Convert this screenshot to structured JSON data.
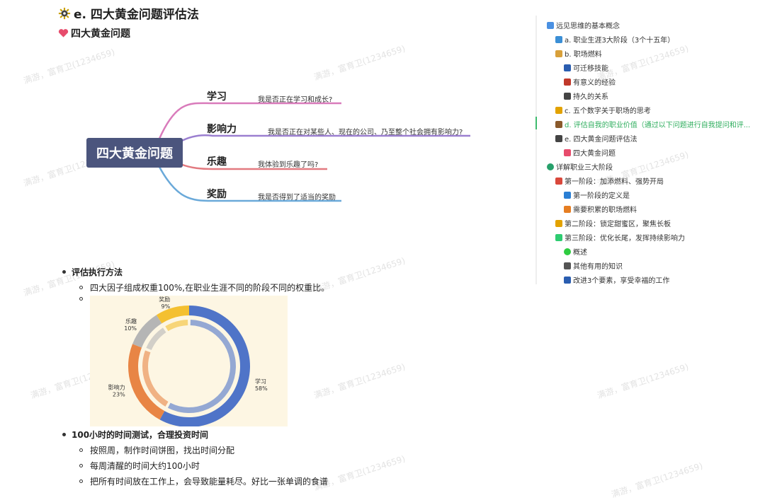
{
  "page": {
    "title": "e. 四大黄金问题评估法",
    "subtitle": "四大黄金问题"
  },
  "mindmap": {
    "center": "四大黄金问题",
    "branches": [
      {
        "label": "学习",
        "question": "我是否正在学习和成长?",
        "color": "#d97bbb"
      },
      {
        "label": "影响力",
        "question": "我是否正在对某些人、现在的公司、乃至整个社会拥有影响力?",
        "color": "#9b7fd0"
      },
      {
        "label": "乐趣",
        "question": "我体验到乐趣了吗?",
        "color": "#e27a80"
      },
      {
        "label": "奖励",
        "question": "我是否得到了适当的奖励",
        "color": "#6aa9d9"
      }
    ]
  },
  "bullets": {
    "item1": {
      "label": "评估执行方法",
      "subs": [
        "四大因子组成权重100%,在职业生涯不同的阶段不同的权重比。"
      ]
    },
    "item2": {
      "label": "100小时的时间测试，合理投资时间",
      "subs": [
        "按照周，制作时间饼图，找出时间分配",
        "每周清醒的时间大约100小时",
        "把所有时间放在工作上，会导致能量耗尽。好比一张单调的食谱"
      ]
    }
  },
  "chart_data": {
    "type": "pie",
    "categories": [
      "学习",
      "影响力",
      "乐趣",
      "奖励"
    ],
    "values": [
      58,
      23,
      10,
      9
    ],
    "labels": [
      "58%",
      "23%",
      "10%",
      "9%"
    ],
    "colors": [
      "#4f74c8",
      "#e88545",
      "#b5b5b5",
      "#f4c030"
    ]
  },
  "toc": {
    "items": [
      {
        "text": "远见思维的基本概念",
        "level": 0,
        "icon": "link-icon",
        "color": "#4a90e2"
      },
      {
        "text": "a. 职业生涯3大阶段（3个十五年）",
        "level": 1,
        "icon": "calendar-icon",
        "color": "#3b8fd6"
      },
      {
        "text": "b. 职场燃料",
        "level": 1,
        "icon": "briefcase-icon",
        "color": "#d8a03a"
      },
      {
        "text": "可迁移技能",
        "level": 2,
        "icon": "car-icon",
        "color": "#2a5db0"
      },
      {
        "text": "有意义的经验",
        "level": 2,
        "icon": "book-icon",
        "color": "#c0392b"
      },
      {
        "text": "持久的关系",
        "level": 2,
        "icon": "people-icon",
        "color": "#444444"
      },
      {
        "text": "c. 五个数字关于职场的思考",
        "level": 1,
        "icon": "trophy-icon",
        "color": "#e2a200"
      },
      {
        "text": "d. 评估自我的职业价值（通过以下问题进行自我提问和评...",
        "level": 1,
        "icon": "badge-icon",
        "color": "#8a5a2b",
        "active": true
      },
      {
        "text": "e. 四大黄金问题评估法",
        "level": 1,
        "icon": "gear-icon",
        "color": "#444444"
      },
      {
        "text": "四大黄金问题",
        "level": 2,
        "icon": "heart-icon",
        "color": "#e74c6c"
      },
      {
        "text": "详解职业三大阶段",
        "level": 0,
        "icon": "globe-icon",
        "color": "#27a06b"
      },
      {
        "text": "第一阶段：加添燃料、强势开局",
        "level": 1,
        "icon": "pin-icon",
        "color": "#d9483b"
      },
      {
        "text": "第一阶段的定义是",
        "level": 2,
        "icon": "info-icon",
        "color": "#2a7fd4"
      },
      {
        "text": "需要积累的职场燃料",
        "level": 2,
        "icon": "flower-icon",
        "color": "#e67e22"
      },
      {
        "text": "第二阶段：锁定甜蜜区，聚焦长板",
        "level": 1,
        "icon": "trophy-icon",
        "color": "#e2a200"
      },
      {
        "text": "第三阶段：优化长尾，发挥持续影响力",
        "level": 1,
        "icon": "chart-icon",
        "color": "#2ecc71"
      },
      {
        "text": "概述",
        "level": 2,
        "icon": "circle-icon",
        "color": "#2ecc40"
      },
      {
        "text": "其他有用的知识",
        "level": 2,
        "icon": "eye-icon",
        "color": "#555555"
      },
      {
        "text": "改进3个要素，享受幸福的工作",
        "level": 2,
        "icon": "info-icon",
        "color": "#2a5db0"
      }
    ]
  },
  "watermark": "满游，富育卫(1234659)"
}
